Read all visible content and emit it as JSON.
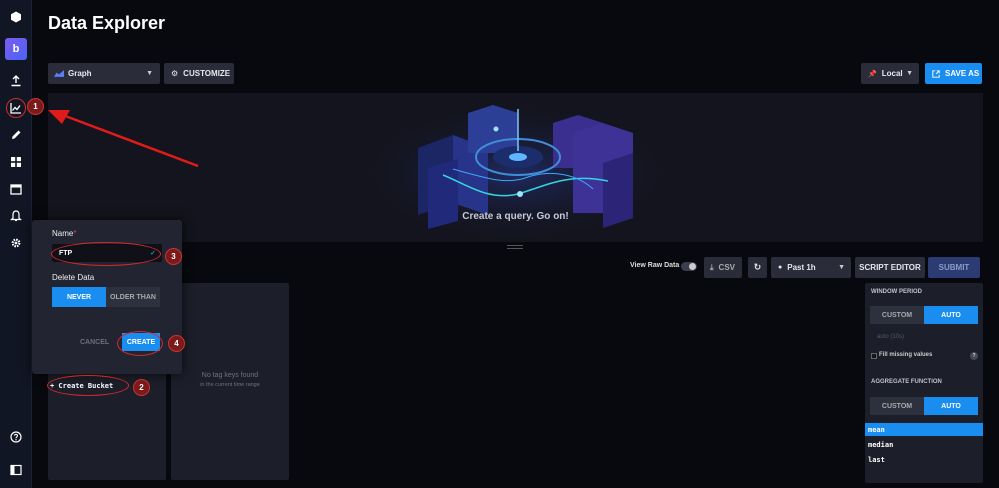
{
  "page": {
    "title": "Data Explorer"
  },
  "nav": {
    "org_initial": "b"
  },
  "toolbar": {
    "view_type": "Graph",
    "customize_label": "CUSTOMIZE",
    "timezone": "Local",
    "save_as_label": "SAVE AS"
  },
  "graph": {
    "empty_message": "Create a query. Go on!"
  },
  "query_bar": {
    "view_raw_label": "View Raw Data",
    "csv_label": "CSV",
    "time_range": "Past 1h",
    "script_editor_label": "SCRIPT EDITOR",
    "submit_label": "SUBMIT"
  },
  "tag_card": {
    "empty_title": "No tag keys found",
    "empty_sub": "in the current time range"
  },
  "create_bucket_label": "+ Create Bucket",
  "popover": {
    "name_label": "Name",
    "required_mark": "*",
    "name_value": "FTP",
    "delete_label": "Delete Data",
    "never_label": "NEVER",
    "older_than_label": "OLDER THAN",
    "cancel_label": "CANCEL",
    "create_label": "CREATE"
  },
  "right_panel": {
    "window_period_label": "WINDOW PERIOD",
    "custom_label": "CUSTOM",
    "auto_label": "AUTO",
    "auto_hint": "auto (10s)",
    "fill_missing_label": "Fill missing values",
    "aggregate_label": "AGGREGATE FUNCTION",
    "functions": [
      "mean",
      "median",
      "last"
    ]
  },
  "annotations": [
    "1",
    "2",
    "3",
    "4"
  ],
  "colors": {
    "accent": "#1a8df0",
    "annotation": "#d42a2a"
  }
}
